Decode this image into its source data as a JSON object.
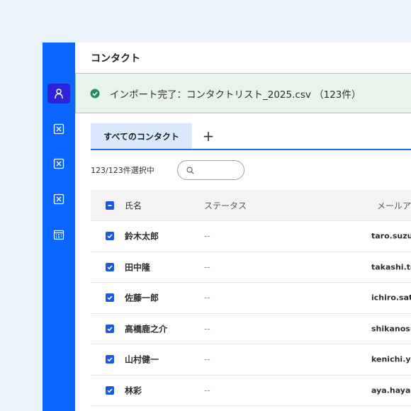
{
  "header": {
    "title": "コンタクト"
  },
  "sidebar": {
    "items": [
      {
        "icon": "person-icon",
        "active": true
      },
      {
        "icon": "close-box-icon",
        "active": false
      },
      {
        "icon": "close-box-icon",
        "active": false
      },
      {
        "icon": "close-box-icon",
        "active": false
      },
      {
        "icon": "calendar-icon",
        "active": false
      }
    ]
  },
  "banner": {
    "icon": "check-circle-icon",
    "text": "インポート完了：コンタクトリスト_2025.csv （123件）"
  },
  "tabs": {
    "items": [
      {
        "label": "すべてのコンタクト"
      }
    ],
    "add_label": "+"
  },
  "toolbar": {
    "selection": "123/123件選択中",
    "search_placeholder": ""
  },
  "table": {
    "columns": {
      "name": "氏名",
      "status": "ステータス",
      "email": "メールア"
    },
    "rows": [
      {
        "name": "鈴木太郎",
        "status": "--",
        "email": "taro.suzul"
      },
      {
        "name": "田中隆",
        "status": "--",
        "email": "takashi.ta"
      },
      {
        "name": "佐藤一郎",
        "status": "--",
        "email": "ichiro.sato"
      },
      {
        "name": "高橋鹿之介",
        "status": "--",
        "email": "shikanosu"
      },
      {
        "name": "山村健一",
        "status": "--",
        "email": "kenichi.ya"
      },
      {
        "name": "林彩",
        "status": "--",
        "email": "aya.hayas"
      }
    ]
  },
  "colors": {
    "sidebar": "#0a66ff",
    "active_nav": "#2c24d6",
    "accent": "#1a57e8",
    "banner_bg": "#e8f3ec",
    "success": "#1e8e5a"
  }
}
